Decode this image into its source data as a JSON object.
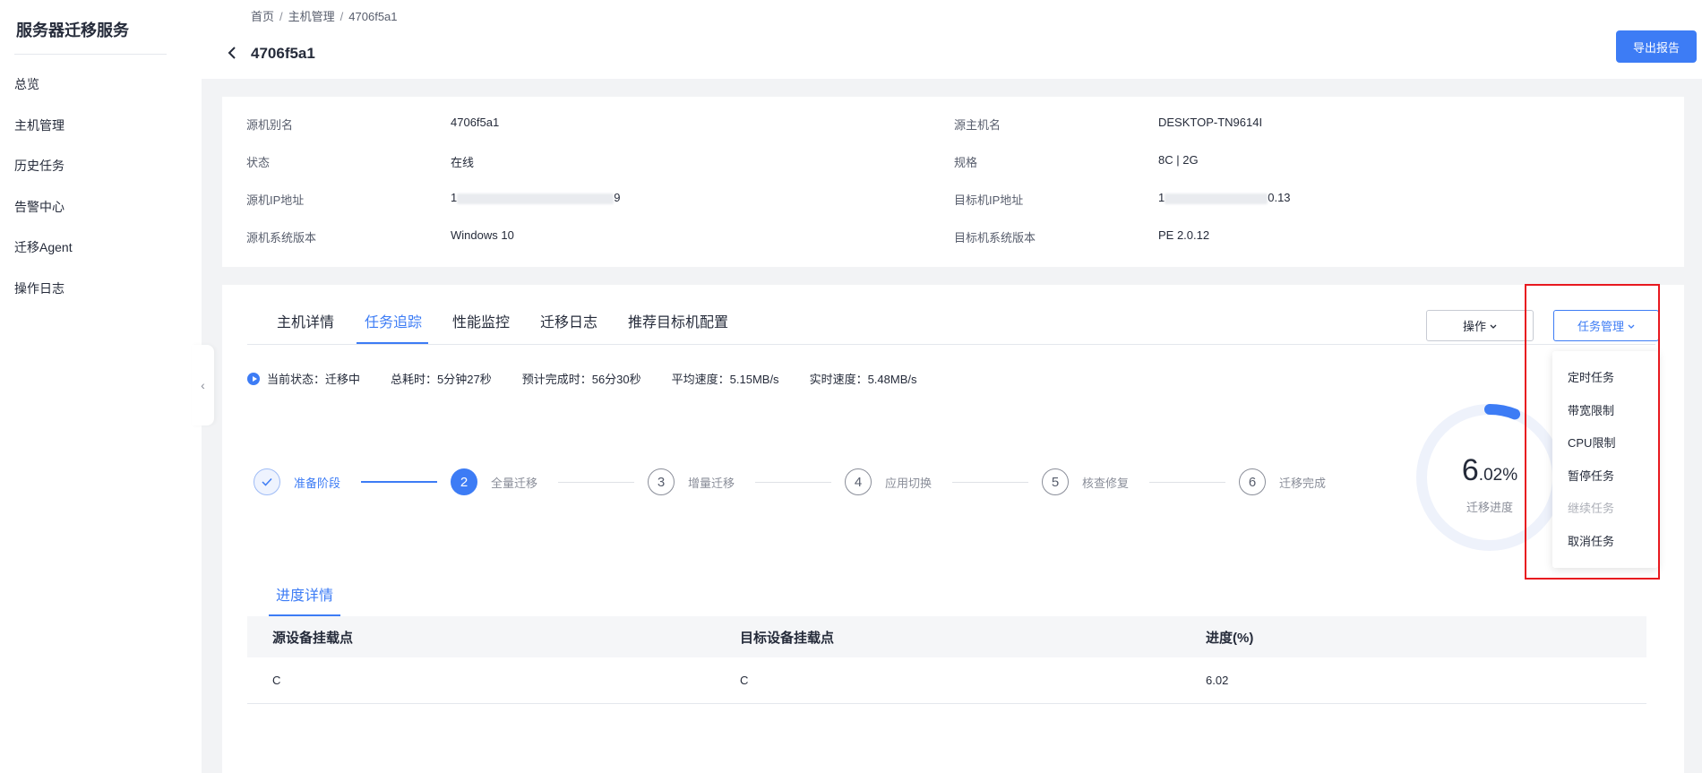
{
  "sidebar": {
    "title": "服务器迁移服务",
    "items": [
      {
        "label": "总览"
      },
      {
        "label": "主机管理"
      },
      {
        "label": "历史任务"
      },
      {
        "label": "告警中心"
      },
      {
        "label": "迁移Agent"
      },
      {
        "label": "操作日志"
      }
    ]
  },
  "header": {
    "breadcrumb": [
      "首页",
      "主机管理",
      "4706f5a1"
    ],
    "title": "4706f5a1",
    "export_label": "导出报告"
  },
  "info": {
    "rows": [
      {
        "label": "源机别名",
        "value": "4706f5a1",
        "label2": "源主机名",
        "value2": "DESKTOP-TN9614I"
      },
      {
        "label": "状态",
        "value": "在线",
        "label2": "规格",
        "value2": "8C | 2G"
      },
      {
        "label": "源机IP地址",
        "value_prefix": "1",
        "value_suffix": "9",
        "label2": "目标机IP地址",
        "value2_prefix": "1",
        "value2_suffix": "0.13"
      },
      {
        "label": "源机系统版本",
        "value": "Windows 10",
        "label2": "目标机系统版本",
        "value2": "PE 2.0.12"
      }
    ]
  },
  "tabs": [
    {
      "label": "主机详情"
    },
    {
      "label": "任务追踪"
    },
    {
      "label": "性能监控"
    },
    {
      "label": "迁移日志"
    },
    {
      "label": "推荐目标机配置"
    }
  ],
  "actions": {
    "operate_label": "操作",
    "task_manage_label": "任务管理"
  },
  "status": {
    "current": "当前状态：迁移中",
    "elapsed": "总耗时：5分钟27秒",
    "eta": "预计完成时：56分30秒",
    "avg_speed": "平均速度：5.15MB/s",
    "realtime_speed": "实时速度：5.48MB/s"
  },
  "steps": [
    {
      "num": "",
      "label": "准备阶段",
      "state": "done"
    },
    {
      "num": "2",
      "label": "全量迁移",
      "state": "current"
    },
    {
      "num": "3",
      "label": "增量迁移",
      "state": "pending"
    },
    {
      "num": "4",
      "label": "应用切换",
      "state": "pending"
    },
    {
      "num": "5",
      "label": "核查修复",
      "state": "pending"
    },
    {
      "num": "6",
      "label": "迁移完成",
      "state": "pending"
    }
  ],
  "progress": {
    "value_int": "6",
    "value_dec": ".02%",
    "fraction": 0.0602,
    "label": "迁移进度"
  },
  "detail": {
    "tab_label": "进度详情",
    "columns": [
      "源设备挂载点",
      "目标设备挂载点",
      "进度(%)"
    ],
    "rows": [
      [
        "C",
        "C",
        "6.02"
      ]
    ]
  },
  "dropdown": {
    "items": [
      {
        "label": "定时任务",
        "disabled": false
      },
      {
        "label": "带宽限制",
        "disabled": false
      },
      {
        "label": "CPU限制",
        "disabled": false
      },
      {
        "label": "暂停任务",
        "disabled": false
      },
      {
        "label": "继续任务",
        "disabled": true
      },
      {
        "label": "取消任务",
        "disabled": false
      }
    ]
  },
  "colors": {
    "accent": "#3d7cf5",
    "highlight": "#e8191f"
  }
}
